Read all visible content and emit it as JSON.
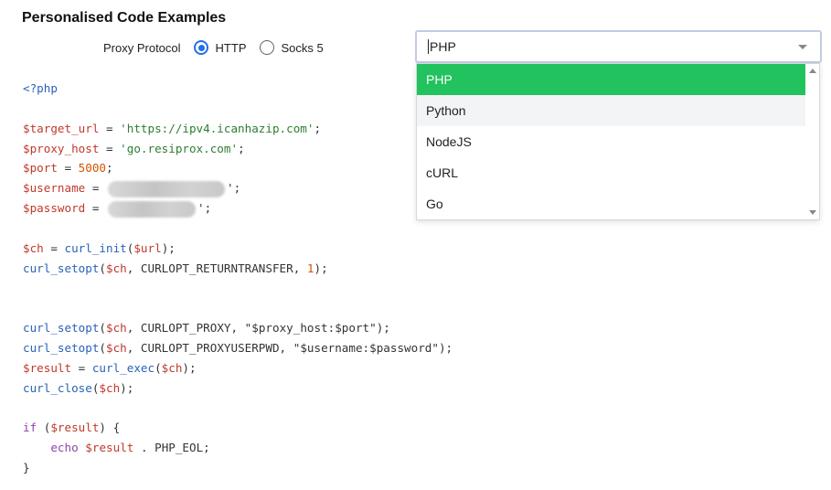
{
  "header": {
    "title": "Personalised Code Examples"
  },
  "protocol": {
    "label": "Proxy Protocol",
    "options": [
      {
        "label": "HTTP",
        "checked": true
      },
      {
        "label": "Socks 5",
        "checked": false
      }
    ]
  },
  "code": {
    "language": "PHP",
    "lines": [
      [
        {
          "t": "kw",
          "v": "<?php"
        }
      ],
      [],
      [
        {
          "t": "var",
          "v": "$target_url"
        },
        {
          "t": "pl",
          "v": " = "
        },
        {
          "t": "str",
          "v": "'https://ipv4.icanhazip.com'"
        },
        {
          "t": "pl",
          "v": ";"
        }
      ],
      [
        {
          "t": "var",
          "v": "$proxy_host"
        },
        {
          "t": "pl",
          "v": " = "
        },
        {
          "t": "str",
          "v": "'go.resiprox.com'"
        },
        {
          "t": "pl",
          "v": ";"
        }
      ],
      [
        {
          "t": "var",
          "v": "$port"
        },
        {
          "t": "pl",
          "v": " = "
        },
        {
          "t": "num",
          "v": "5000"
        },
        {
          "t": "pl",
          "v": ";"
        }
      ],
      [
        {
          "t": "var",
          "v": "$username"
        },
        {
          "t": "pl",
          "v": " = "
        },
        {
          "t": "blur",
          "v": ""
        },
        {
          "t": "pl",
          "v": "';"
        }
      ],
      [
        {
          "t": "var",
          "v": "$password"
        },
        {
          "t": "pl",
          "v": " = "
        },
        {
          "t": "blur-short",
          "v": ""
        },
        {
          "t": "pl",
          "v": "';"
        }
      ],
      [],
      [
        {
          "t": "var",
          "v": "$ch"
        },
        {
          "t": "pl",
          "v": " = "
        },
        {
          "t": "fn",
          "v": "curl_init"
        },
        {
          "t": "pl",
          "v": "("
        },
        {
          "t": "var",
          "v": "$url"
        },
        {
          "t": "pl",
          "v": ");"
        }
      ],
      [
        {
          "t": "fn",
          "v": "curl_setopt"
        },
        {
          "t": "pl",
          "v": "("
        },
        {
          "t": "var",
          "v": "$ch"
        },
        {
          "t": "pl",
          "v": ", CURLOPT_RETURNTRANSFER, "
        },
        {
          "t": "num",
          "v": "1"
        },
        {
          "t": "pl",
          "v": ");"
        }
      ],
      [],
      [],
      [
        {
          "t": "fn",
          "v": "curl_setopt"
        },
        {
          "t": "pl",
          "v": "("
        },
        {
          "t": "var",
          "v": "$ch"
        },
        {
          "t": "pl",
          "v": ", CURLOPT_PROXY, "
        },
        {
          "t": "pl",
          "v": "\"$proxy_host:$port\""
        },
        {
          "t": "pl",
          "v": ");"
        }
      ],
      [
        {
          "t": "fn",
          "v": "curl_setopt"
        },
        {
          "t": "pl",
          "v": "("
        },
        {
          "t": "var",
          "v": "$ch"
        },
        {
          "t": "pl",
          "v": ", CURLOPT_PROXYUSERPWD, "
        },
        {
          "t": "pl",
          "v": "\"$username:$password\""
        },
        {
          "t": "pl",
          "v": ");"
        }
      ],
      [
        {
          "t": "var",
          "v": "$result"
        },
        {
          "t": "pl",
          "v": " = "
        },
        {
          "t": "fn",
          "v": "curl_exec"
        },
        {
          "t": "pl",
          "v": "("
        },
        {
          "t": "var",
          "v": "$ch"
        },
        {
          "t": "pl",
          "v": ");"
        }
      ],
      [
        {
          "t": "fn",
          "v": "curl_close"
        },
        {
          "t": "pl",
          "v": "("
        },
        {
          "t": "var",
          "v": "$ch"
        },
        {
          "t": "pl",
          "v": ");"
        }
      ],
      [],
      [
        {
          "t": "ctl",
          "v": "if"
        },
        {
          "t": "pl",
          "v": " ("
        },
        {
          "t": "var",
          "v": "$result"
        },
        {
          "t": "pl",
          "v": ") {"
        }
      ],
      [
        {
          "t": "pl",
          "v": "    "
        },
        {
          "t": "ctl",
          "v": "echo"
        },
        {
          "t": "pl",
          "v": " "
        },
        {
          "t": "var",
          "v": "$result"
        },
        {
          "t": "pl",
          "v": " . PHP_EOL;"
        }
      ],
      [
        {
          "t": "pl",
          "v": "}"
        }
      ]
    ]
  },
  "language_select": {
    "value": "PHP",
    "options": [
      {
        "label": "PHP",
        "state": "selected"
      },
      {
        "label": "Python",
        "state": "hover"
      },
      {
        "label": "NodeJS",
        "state": ""
      },
      {
        "label": "cURL",
        "state": ""
      },
      {
        "label": "Go",
        "state": ""
      }
    ]
  },
  "colors": {
    "accent_radio": "#1f6feb",
    "selected_option": "#22c25e"
  }
}
